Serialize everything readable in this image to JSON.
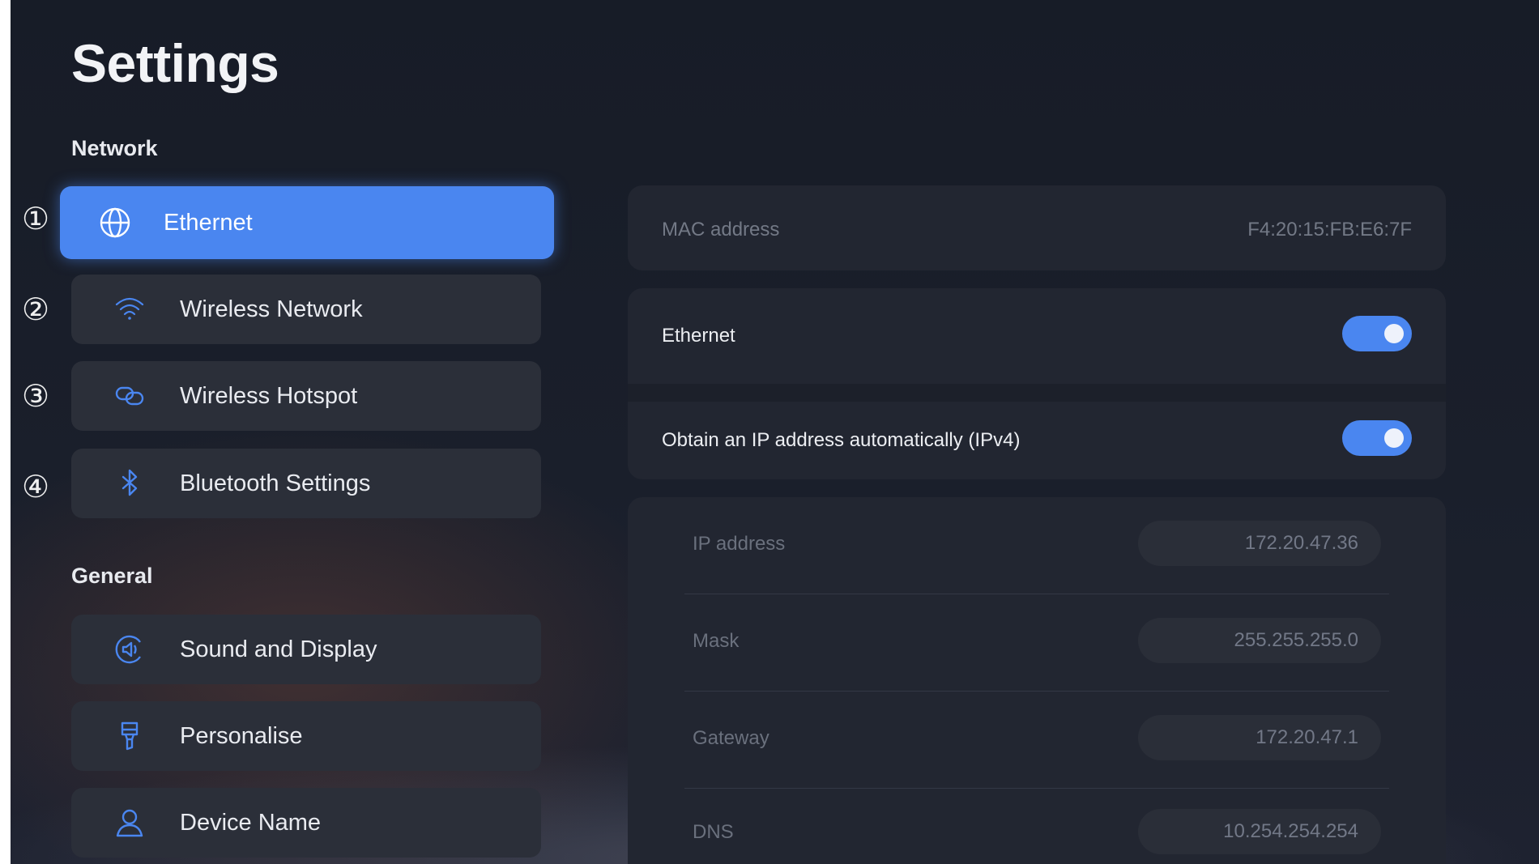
{
  "header": {
    "title": "Settings"
  },
  "sidebar": {
    "sections": [
      {
        "title": "Network"
      },
      {
        "title": "General"
      }
    ],
    "items": [
      {
        "label": "Ethernet",
        "icon": "globe-icon",
        "marker": "①",
        "active": true
      },
      {
        "label": "Wireless Network",
        "icon": "wifi-icon",
        "marker": "②"
      },
      {
        "label": "Wireless Hotspot",
        "icon": "hotspot-link-icon",
        "marker": "③"
      },
      {
        "label": "Bluetooth Settings",
        "icon": "bluetooth-icon",
        "marker": "④"
      },
      {
        "label": "Sound and Display",
        "icon": "speaker-icon"
      },
      {
        "label": "Personalise",
        "icon": "paintbrush-icon"
      },
      {
        "label": "Device Name",
        "icon": "user-icon"
      }
    ]
  },
  "detail": {
    "mac": {
      "label": "MAC address",
      "value": "F4:20:15:FB:E6:7F"
    },
    "ethernet_toggle": {
      "label": "Ethernet",
      "on": true
    },
    "auto_ip_toggle": {
      "label": "Obtain an IP address automatically (IPv4)",
      "on": true
    },
    "ip_fields": [
      {
        "label": "IP address",
        "value": "172.20.47.36"
      },
      {
        "label": "Mask",
        "value": "255.255.255.0"
      },
      {
        "label": "Gateway",
        "value": "172.20.47.1"
      },
      {
        "label": "DNS",
        "value": "10.254.254.254"
      }
    ]
  },
  "colors": {
    "accent": "#4a86f0",
    "background": "#1a1f2b",
    "card": "#222631",
    "menu_item": "#2b2f39",
    "icon": "#4a86f0"
  }
}
